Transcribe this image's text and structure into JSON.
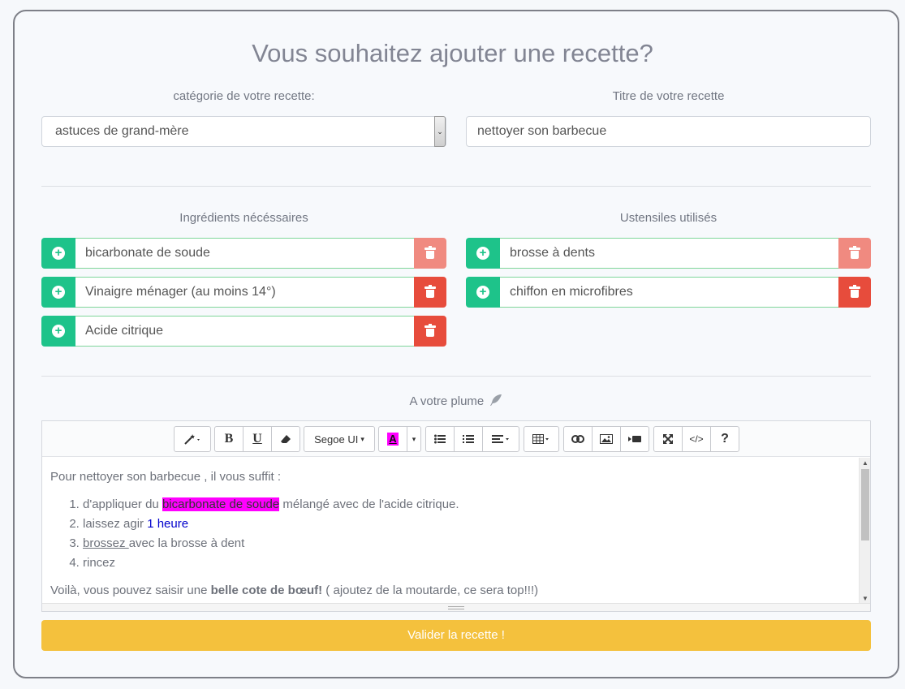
{
  "title": "Vous souhaitez ajouter une recette?",
  "category": {
    "label": "catégorie de votre recette:",
    "value": "astuces de grand-mère",
    "arrow": "⌄"
  },
  "recipe_title": {
    "label": "Titre de votre recette",
    "value": "nettoyer son barbecue"
  },
  "ingredients": {
    "label": "Ingrédients nécéssaires",
    "items": [
      {
        "text": "bicarbonate de soude"
      },
      {
        "text": "Vinaigre ménager (au moins 14°)"
      },
      {
        "text": "Acide citrique"
      }
    ]
  },
  "utensils": {
    "label": "Ustensiles utilisés",
    "items": [
      {
        "text": "brosse à dents"
      },
      {
        "text": "chiffon en microfibres"
      }
    ]
  },
  "editor": {
    "label": "A votre plume",
    "font_select": "Segoe UI",
    "toolbar_glyphs": {
      "bold": "B",
      "underline": "U",
      "help": "?",
      "code": "</>",
      "caret": "▾",
      "color_letter": "A"
    },
    "content": {
      "intro": "Pour nettoyer son barbecue , il vous suffit :",
      "step1_a": "d'appliquer du ",
      "step1_hl": "bicarbonate de soude",
      "step1_b": " mélangé avec de l'acide citrique.",
      "step2_a": "laissez agir ",
      "step2_b": "1 heure",
      "step3_a": "brossez ",
      "step3_b": "avec la brosse à dent",
      "step4": "rincez",
      "outro_a": "Voilà, vous pouvez saisir une ",
      "outro_b": "belle cote de bœuf!",
      "outro_c": " ( ajoutez de la moutarde, ce sera top!!!)"
    },
    "scroll": {
      "up": "▲",
      "down": "▼"
    }
  },
  "submit_label": "Valider la recette !",
  "colors": {
    "green": "#1ec38a",
    "red": "#e74c3c",
    "yellow": "#f4c13d",
    "highlight": "#ff00ff"
  }
}
